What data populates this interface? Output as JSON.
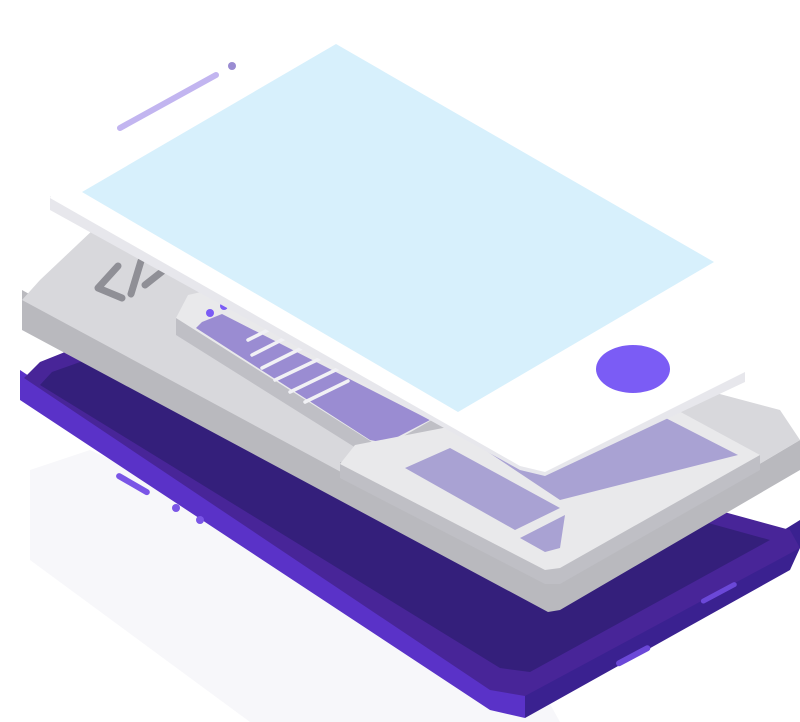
{
  "illustration": {
    "code_symbol": "</>",
    "layers": [
      "phone-body",
      "code-layer",
      "layout-layer",
      "screen-layer"
    ]
  },
  "colors": {
    "phone_front": "#482598",
    "phone_screen": "#341f7b",
    "phone_side": "#5a32c8",
    "phone_bottom_edge": "#2d1a6e",
    "code_layer_top": "#d9d9dc",
    "code_layer_side": "#b8b8bd",
    "code_block": "#e8e8ea",
    "code_block_fill": "#9a8cd2",
    "layout_panel": "#a9a2d3",
    "screen_top": "#ffffff",
    "screen_side": "#e7e7ec",
    "screen_display": "#d7f0fc",
    "home_button": "#7b5cf5",
    "accent_line": "#c2b5f0",
    "shadow": "#eeeef4"
  },
  "icons": [
    "code-brackets-icon",
    "home-button-icon"
  ]
}
